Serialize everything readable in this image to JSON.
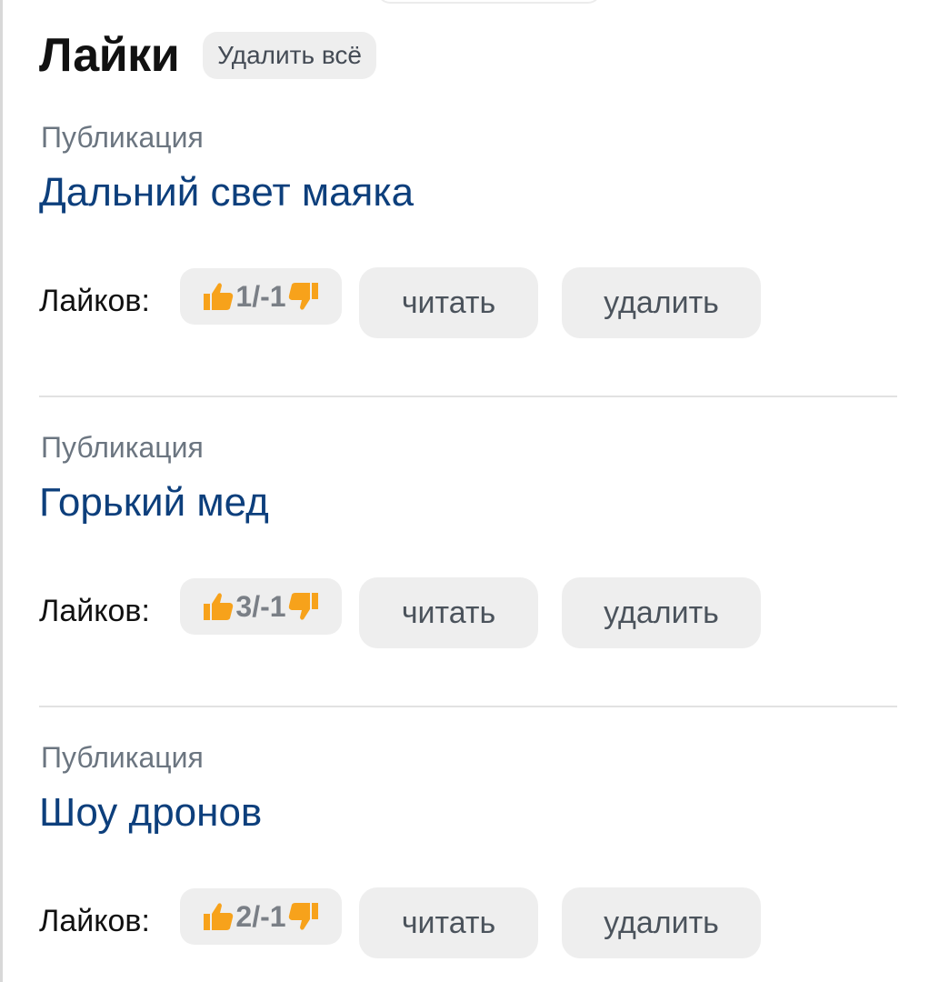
{
  "header": {
    "title": "Лайки",
    "delete_all_label": "Удалить всё"
  },
  "items": [
    {
      "type_label": "Публикация",
      "title": "Дальний свет маяка",
      "likes_label": "Лайков:",
      "likes_value": "1/-1",
      "read_label": "читать",
      "delete_label": "удалить"
    },
    {
      "type_label": "Публикация",
      "title": "Горький мед",
      "likes_label": "Лайков:",
      "likes_value": "3/-1",
      "read_label": "читать",
      "delete_label": "удалить"
    },
    {
      "type_label": "Публикация",
      "title": "Шоу дронов",
      "likes_label": "Лайков:",
      "likes_value": "2/-1",
      "read_label": "читать",
      "delete_label": "удалить"
    }
  ],
  "icons": {
    "like": "thumbs-up-icon",
    "dislike": "thumbs-down-icon"
  },
  "colors": {
    "link_title": "#0d3f7c",
    "thumb_accent": "#f7a21b",
    "button_bg": "#eeeeee"
  }
}
